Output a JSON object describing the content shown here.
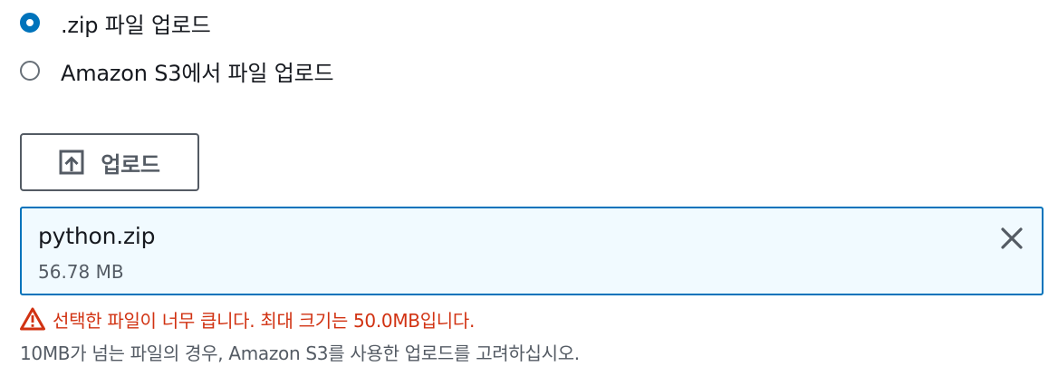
{
  "upload_source": {
    "options": [
      {
        "label": ".zip 파일 업로드",
        "selected": true
      },
      {
        "label": "Amazon S3에서 파일 업로드",
        "selected": false
      }
    ]
  },
  "upload_button": {
    "label": "업로드",
    "icon": "upload-icon"
  },
  "selected_file": {
    "name": "python.zip",
    "size": "56.78 MB",
    "remove_icon": "close-icon"
  },
  "validation": {
    "error_icon": "warning-icon",
    "error": "선택한 파일이 너무 큽니다. 최대 크기는 50.0MB입니다.",
    "hint": "10MB가 넘는 파일의 경우, Amazon S3를 사용한 업로드를 고려하십시오."
  },
  "colors": {
    "accent": "#0073bb",
    "error": "#d13212",
    "card_background": "#f1faff",
    "secondary_text": "#545b64"
  }
}
